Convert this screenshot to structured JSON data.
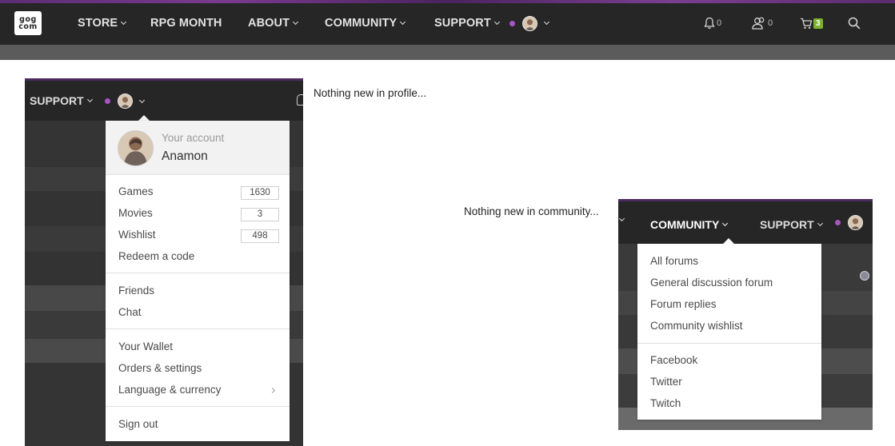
{
  "brand": {
    "logo_line1": "gog",
    "logo_line2": "com"
  },
  "topnav": {
    "items": [
      {
        "label": "STORE"
      },
      {
        "label": "RPG MONTH"
      },
      {
        "label": "ABOUT"
      },
      {
        "label": "COMMUNITY"
      },
      {
        "label": "SUPPORT"
      }
    ],
    "notifications_count": "0",
    "friends_count": "0",
    "cart_count": "3"
  },
  "profile_panel": {
    "nav_support": "SUPPORT",
    "account_label": "Your account",
    "username": "Anamon",
    "items": [
      {
        "label": "Games",
        "count": "1630"
      },
      {
        "label": "Movies",
        "count": "3"
      },
      {
        "label": "Wishlist",
        "count": "498"
      },
      {
        "label": "Redeem a code"
      },
      {
        "label": "Friends"
      },
      {
        "label": "Chat"
      },
      {
        "label": "Your Wallet"
      },
      {
        "label": "Orders & settings"
      },
      {
        "label": "Language & currency"
      },
      {
        "label": "Sign out"
      }
    ]
  },
  "notes": {
    "profile": "Nothing new in profile...",
    "community": "Nothing new in community..."
  },
  "community_panel": {
    "nav_community": "COMMUNITY",
    "nav_support": "SUPPORT",
    "items": [
      {
        "label": "All forums"
      },
      {
        "label": "General discussion forum"
      },
      {
        "label": "Forum replies"
      },
      {
        "label": "Community wishlist"
      },
      {
        "label": "Facebook"
      },
      {
        "label": "Twitter"
      },
      {
        "label": "Twitch"
      }
    ]
  },
  "colors": {
    "topbar": "#262626",
    "accent_purple": "#a855c4",
    "cart_badge": "#7cb32a"
  }
}
